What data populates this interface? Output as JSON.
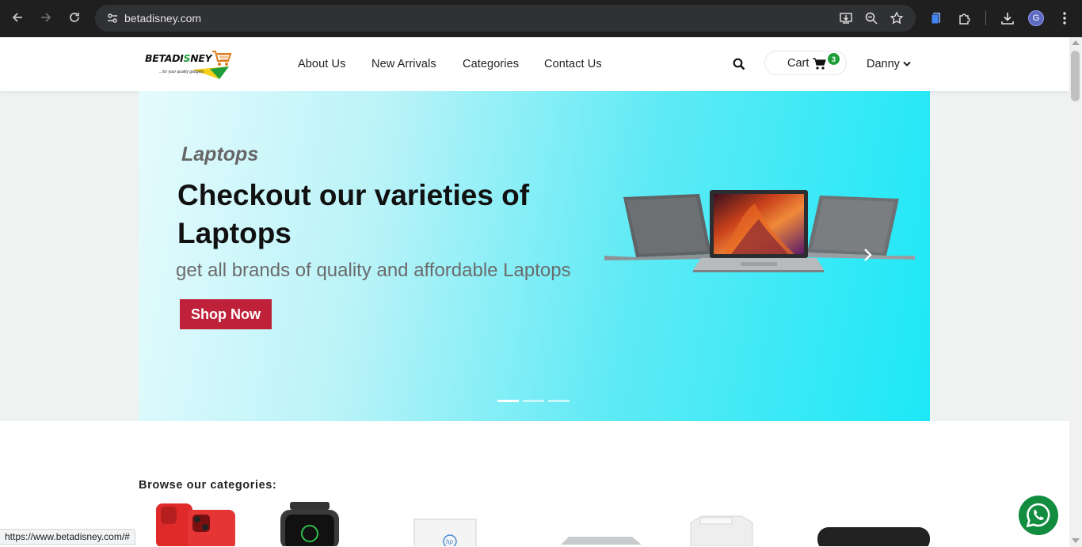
{
  "browser": {
    "url": "betadisney.com",
    "avatar_initial": "G",
    "status_url": "https://www.betadisney.com/#"
  },
  "site": {
    "logo": {
      "name_part1": "BETADI",
      "name_part2": "S",
      "name_part3": "NEY",
      "tagline": "...for your quality gadgets"
    },
    "menu": [
      {
        "label": "About Us"
      },
      {
        "label": "New Arrivals"
      },
      {
        "label": "Categories"
      },
      {
        "label": "Contact Us"
      }
    ],
    "cart": {
      "label": "Cart",
      "count": "3"
    },
    "user": {
      "name": "Danny"
    }
  },
  "hero": {
    "eyebrow": "Laptops",
    "title": "Checkout our varieties of Laptops",
    "subtitle": "get all brands of quality and affordable Laptops",
    "cta": "Shop Now",
    "slides_total": 3,
    "active_slide": 1
  },
  "categories": {
    "title": "Browse our categories:",
    "items": [
      "phone",
      "smartwatch",
      "hp-laptop",
      "laptop",
      "printer",
      "speaker"
    ]
  },
  "colors": {
    "accent_red": "#c0213a",
    "badge_green": "#1f9d3a",
    "whatsapp_green": "#128c3e",
    "hero_cyan": "#1ce8f7"
  },
  "icons": [
    "back-icon",
    "forward-icon",
    "reload-icon",
    "site-info-icon",
    "install-app-icon",
    "zoom-icon",
    "bookmark-star-icon",
    "extension-icon",
    "puzzle-icon",
    "download-icon",
    "kebab-menu-icon",
    "search-icon",
    "cart-icon",
    "chevron-down-icon",
    "chevron-right-icon",
    "whatsapp-icon"
  ]
}
